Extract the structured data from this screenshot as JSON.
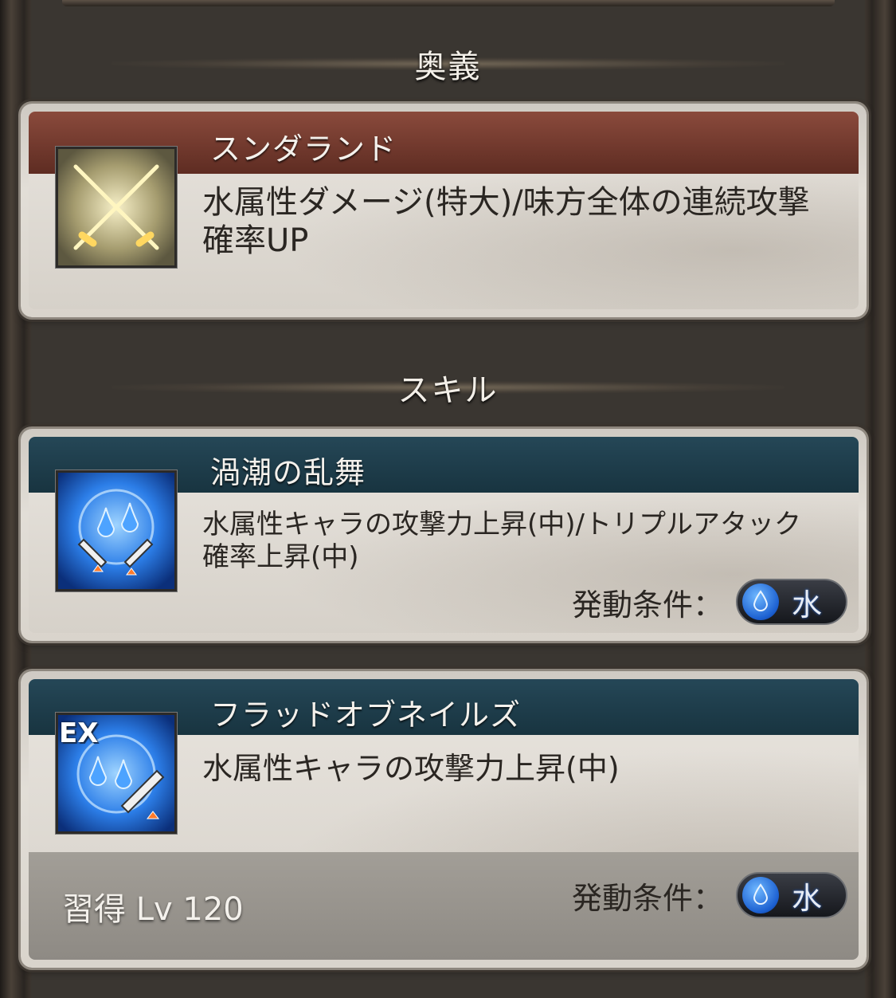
{
  "sections": {
    "ougi": "奥義",
    "skill": "スキル"
  },
  "ougi": {
    "name": "スンダランド",
    "icon": "crossed-swords-icon",
    "description": "水属性ダメージ(特大)/味方全体の連続攻撃確率UP"
  },
  "skills": [
    {
      "name": "渦潮の乱舞",
      "icon": "water-attack-triple-icon",
      "description": "水属性キャラの攻撃力上昇(中)/トリプルアタック確率上昇(中)",
      "condition_label": "発動条件：",
      "condition_element": "水"
    },
    {
      "name": "フラッドオブネイルズ",
      "icon": "ex-water-attack-icon",
      "badge": "EX",
      "description": "水属性キャラの攻撃力上昇(中)",
      "learn_level": "習得 Lv 120",
      "condition_label": "発動条件：",
      "condition_element": "水"
    }
  ],
  "colors": {
    "ougi_title_bar": "#7a3b2f",
    "skill_title_bar": "#1f3f4d",
    "water": "#2a6ad8"
  }
}
